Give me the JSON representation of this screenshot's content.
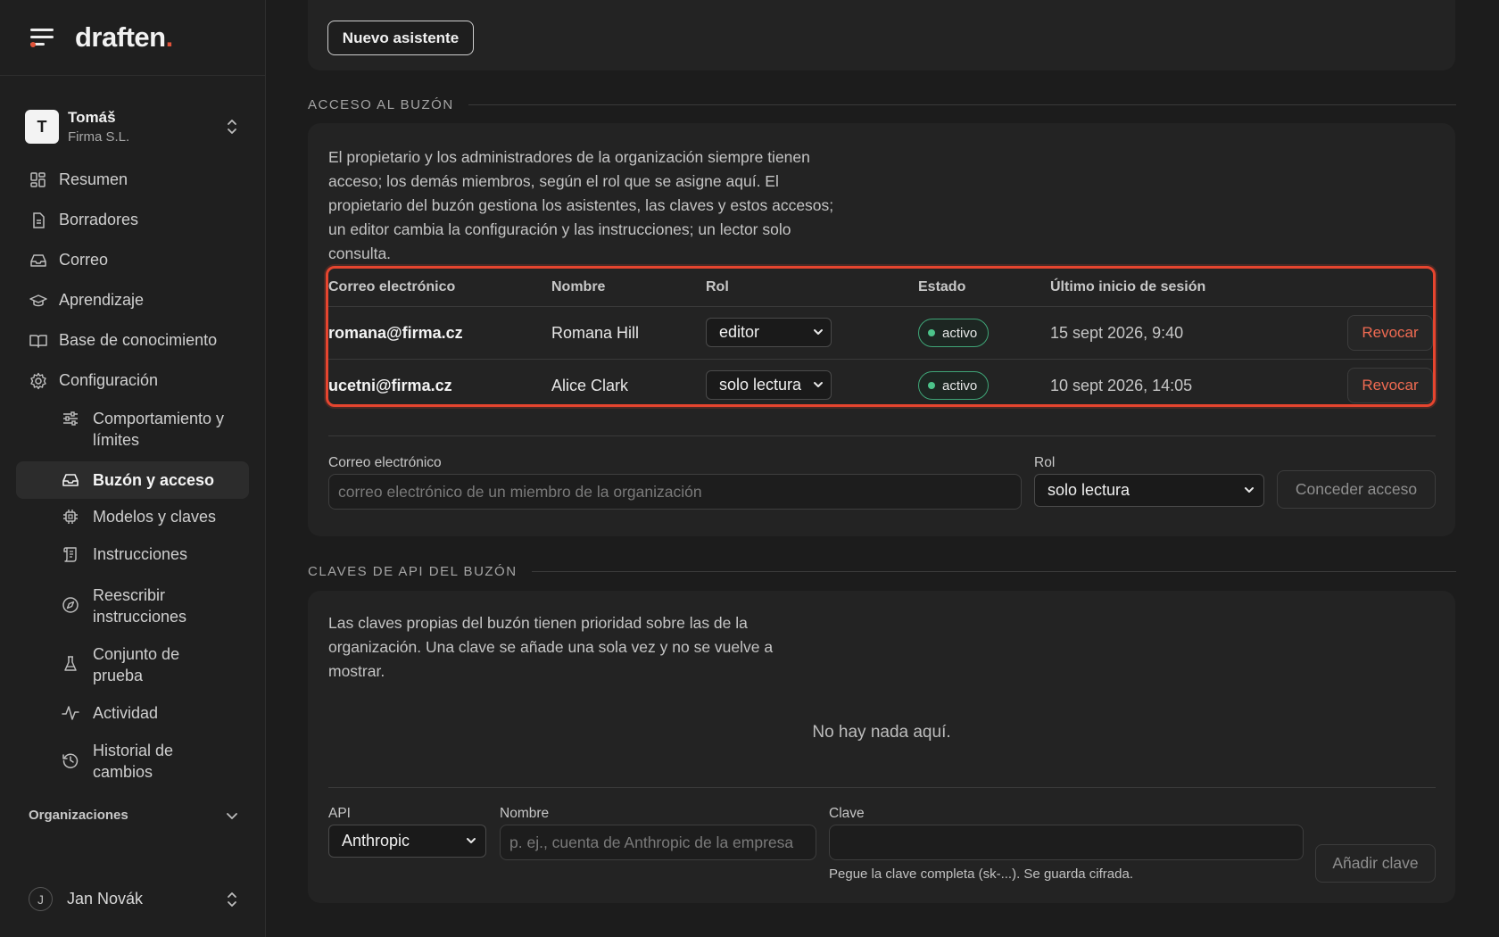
{
  "app": {
    "logo": "draften",
    "logo_dot": "."
  },
  "account": {
    "initial": "T",
    "name": "Tomáš",
    "org": "Firma S.L."
  },
  "nav": {
    "items": [
      {
        "label": "Resumen",
        "icon": "dashboard-icon"
      },
      {
        "label": "Borradores",
        "icon": "document-icon"
      },
      {
        "label": "Correo",
        "icon": "inbox-icon"
      },
      {
        "label": "Aprendizaje",
        "icon": "graduation-cap-icon"
      },
      {
        "label": "Base de conocimiento",
        "icon": "book-icon"
      },
      {
        "label": "Configuración",
        "icon": "gear-icon"
      }
    ],
    "sub_items": [
      {
        "label": "Comportamiento y límites",
        "icon": "sliders-icon"
      },
      {
        "label": "Buzón y acceso",
        "icon": "inbox-icon",
        "active": true
      },
      {
        "label": "Modelos y claves",
        "icon": "chip-icon"
      },
      {
        "label": "Instrucciones",
        "icon": "scroll-icon"
      },
      {
        "label": "Reescribir instrucciones",
        "icon": "compass-icon"
      },
      {
        "label": "Conjunto de prueba",
        "icon": "flask-icon"
      },
      {
        "label": "Actividad",
        "icon": "activity-icon"
      },
      {
        "label": "Historial de cambios",
        "icon": "history-icon"
      }
    ],
    "organizations_label": "Organizaciones"
  },
  "user": {
    "initial": "J",
    "name": "Jan Novák"
  },
  "top": {
    "new_assistant_button": "Nuevo asistente"
  },
  "access": {
    "section_title": "ACCESO AL BUZÓN",
    "description": "El propietario y los administradores de la organización siempre tienen acceso; los demás miembros, según el rol que se asigne aquí. El propietario del buzón gestiona los asistentes, las claves y estos accesos; un editor cambia la configuración y las instrucciones; un lector solo consulta.",
    "columns": [
      "Correo electrónico",
      "Nombre",
      "Rol",
      "Estado",
      "Último inicio de sesión"
    ],
    "rows": [
      {
        "email": "romana@firma.cz",
        "name": "Romana Hill",
        "role": "editor",
        "status": "activo",
        "last_login": "15 sept 2026, 9:40",
        "action": "Revocar"
      },
      {
        "email": "ucetni@firma.cz",
        "name": "Alice Clark",
        "role": "solo lectura",
        "status": "activo",
        "last_login": "10 sept 2026, 14:05",
        "action": "Revocar"
      }
    ],
    "form": {
      "email_label": "Correo electrónico",
      "email_placeholder": "correo electrónico de un miembro de la organización",
      "role_label": "Rol",
      "role_value": "solo lectura",
      "submit": "Conceder acceso"
    }
  },
  "api_keys": {
    "section_title": "CLAVES DE API DEL BUZÓN",
    "description": "Las claves propias del buzón tienen prioridad sobre las de la organización. Una clave se añade una sola vez y no se vuelve a mostrar.",
    "empty": "No hay nada aquí.",
    "form": {
      "api_label": "API",
      "api_value": "Anthropic",
      "name_label": "Nombre",
      "name_placeholder": "p. ej., cuenta de Anthropic de la empresa",
      "key_label": "Clave",
      "key_hint": "Pegue la clave completa (sk-...). Se guarda cifrada.",
      "submit": "Añadir clave"
    }
  },
  "colors": {
    "accent": "#e0533a",
    "active_green": "#4cc38a",
    "revoke": "#f06b52"
  }
}
